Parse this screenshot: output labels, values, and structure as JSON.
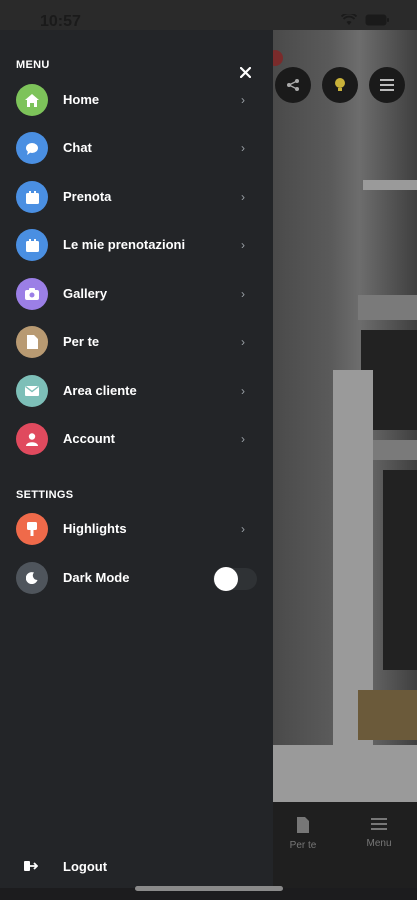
{
  "status": {
    "time": "10:57"
  },
  "drawer": {
    "menu_title": "MENU",
    "settings_title": "SETTINGS",
    "menu_items": [
      {
        "label": "Home",
        "icon": "home-icon",
        "color": "#7dc35a"
      },
      {
        "label": "Chat",
        "icon": "chat-icon",
        "color": "#4a8fe2"
      },
      {
        "label": "Prenota",
        "icon": "calendar-icon",
        "color": "#4a8fe2"
      },
      {
        "label": "Le mie prenotazioni",
        "icon": "calendar-icon",
        "color": "#4a8fe2"
      },
      {
        "label": "Gallery",
        "icon": "camera-icon",
        "color": "#9b7fe6"
      },
      {
        "label": "Per te",
        "icon": "document-icon",
        "color": "#b89a72"
      },
      {
        "label": "Area cliente",
        "icon": "mail-icon",
        "color": "#7dbfb8"
      },
      {
        "label": "Account",
        "icon": "user-icon",
        "color": "#e04a5e"
      }
    ],
    "settings_items": [
      {
        "label": "Highlights",
        "icon": "highlight-icon",
        "color": "#ef6a4a"
      },
      {
        "label": "Dark Mode",
        "icon": "moon-icon",
        "color": "#4f555c",
        "toggle_on": false
      }
    ],
    "logout_label": "Logout"
  },
  "background": {
    "tabs": [
      {
        "label": "Per te",
        "icon": "document-icon"
      },
      {
        "label": "Menu",
        "icon": "menu-icon"
      }
    ]
  }
}
